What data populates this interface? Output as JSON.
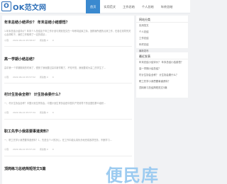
{
  "site": {
    "logo_mark": "O",
    "logo_text": "OK范文网"
  },
  "nav": [
    "首页",
    "实用范文",
    "工作总结",
    "个人总结",
    "年终总结"
  ],
  "posts": [
    {
      "title": "年末总结小结评价？ 年末总结小结感悟？",
      "excerpt": "1.年末总结小结评价？年末个人总结及下年工作计划与规划范文在一年即将结束之际，回顾我所做的点滴工作，在各位领导的关心及帮助下，我的工作取得了一定的成绩...",
      "meta": [
        "小薇",
        "2022-06-12 05:58:07",
        "阅读数 0",
        "0"
      ]
    },
    {
      "title": "高一学期小结总结？",
      "excerpt": "高中第一个学期期末的时间了，很快了我就要过高中新学期了，不知不觉，我就要成为高二的学生了...",
      "meta": [
        "小薇",
        "2022-06-12 05:57:52",
        "阅读数 0",
        "0"
      ]
    },
    {
      "title": "村计生协会全称？ 计生协会委什么？",
      "excerpt": "一、村计生协会全称？中国计划生育协会，中国计划生育协会是中国共产党领导下的全国性群众组织...",
      "meta": [
        "小薇",
        "2022-06-12 05:57:34",
        "阅读数 0",
        "0"
      ]
    },
    {
      "title": "职工先学小我思要事道资料？",
      "excerpt": "一、职工先学小我思要事道资料？1、先进当个人的决心，在工作中能认真负责地完成各项任务，不断学习...",
      "meta": [
        "小薇",
        "2022-06-12 05:57:20",
        "阅读数 0",
        "0"
      ]
    },
    {
      "title": "顶岗练习总结简短范文5篇",
      "excerpt": "",
      "meta": []
    }
  ],
  "sidebar": {
    "categories": {
      "title": "网站分类",
      "items": [
        "实用范文",
        "个人总结",
        "工作总结",
        "年终总结",
        "最新发布"
      ]
    },
    "latest": {
      "title": "最近发表",
      "items": [
        "年末总结小结评价？ 年末总结小结感悟？",
        "高一学期小结总结？",
        "村计生协会全称？ 计生协会委什么？",
        "职工先学小我思要事道资料？",
        "顶岗练习总结简短范文5篇"
      ]
    }
  },
  "watermark": "便民库"
}
